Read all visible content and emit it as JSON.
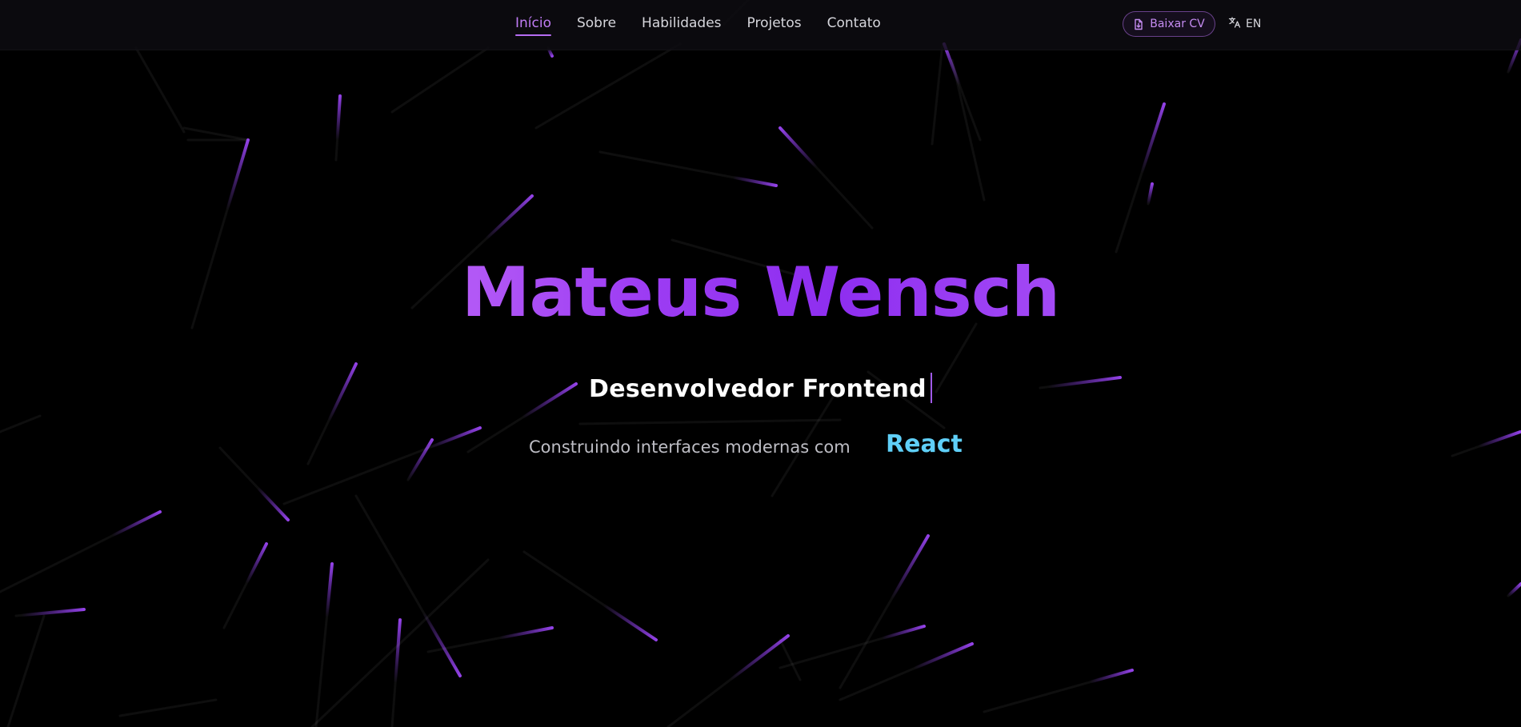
{
  "navbar": {
    "links": [
      {
        "label": "Início",
        "active": true
      },
      {
        "label": "Sobre",
        "active": false
      },
      {
        "label": "Habilidades",
        "active": false
      },
      {
        "label": "Projetos",
        "active": false
      },
      {
        "label": "Contato",
        "active": false
      }
    ],
    "cv_button": {
      "label": "Baixar CV",
      "icon": "file-download-icon"
    },
    "language_toggle": {
      "label": "EN",
      "icon": "translate-icon"
    }
  },
  "hero": {
    "name": "Mateus Wensch",
    "role": "Desenvolvedor Frontend",
    "tagline": "Construindo interfaces modernas com",
    "technology": "React"
  },
  "colors": {
    "background": "#000000",
    "accent": "#b66df2",
    "accent_deep": "#8e2ef0",
    "tech_highlight": "#5fcff8",
    "nav_text": "#d6d6dc"
  }
}
